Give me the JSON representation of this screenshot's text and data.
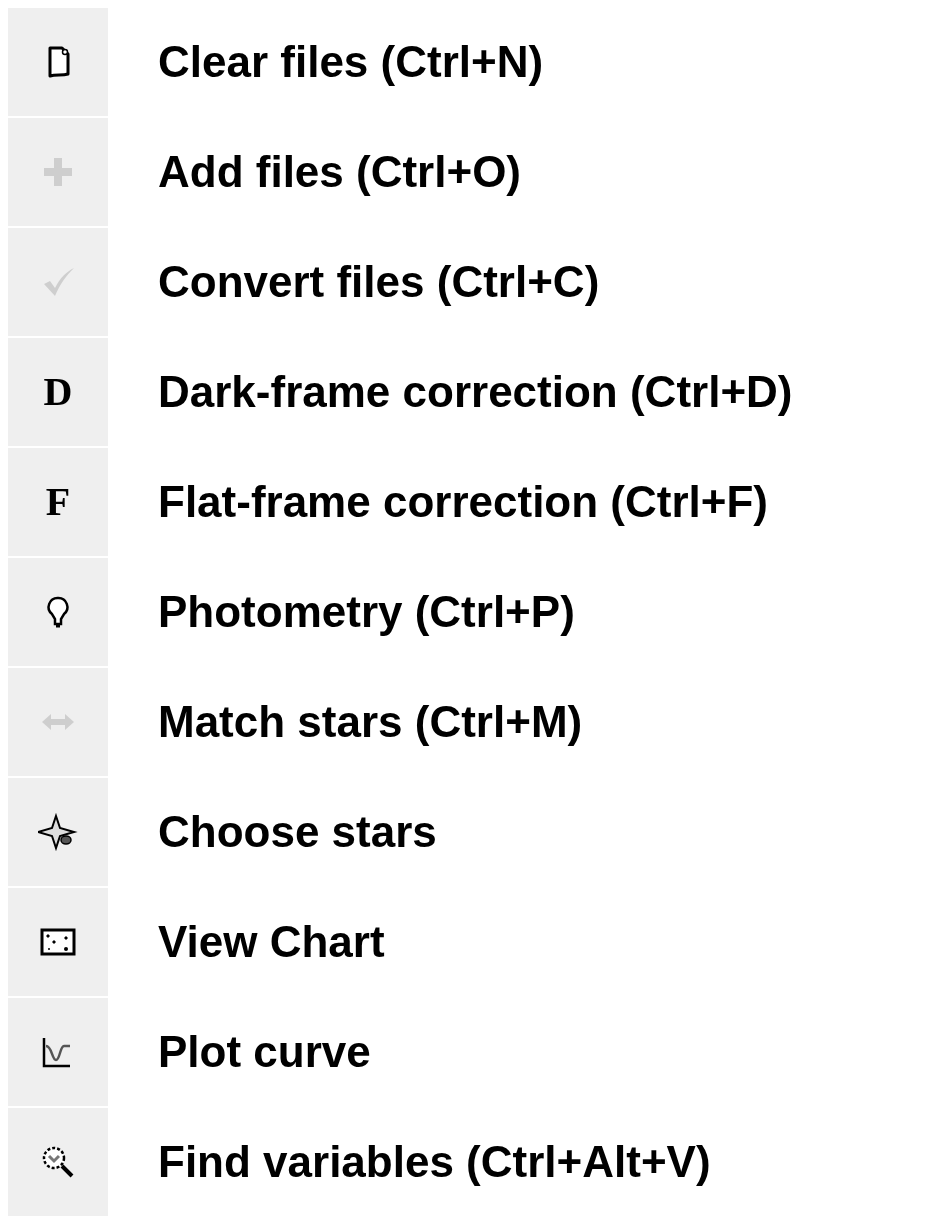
{
  "items": [
    {
      "kind": "page",
      "disabled": false,
      "label": "Clear files (Ctrl+N)"
    },
    {
      "kind": "plus",
      "disabled": true,
      "label": "Add files (Ctrl+O)"
    },
    {
      "kind": "check",
      "disabled": true,
      "label": "Convert files (Ctrl+C)"
    },
    {
      "kind": "letter",
      "glyph": "D",
      "disabled": false,
      "label": "Dark-frame correction (Ctrl+D)"
    },
    {
      "kind": "letter",
      "glyph": "F",
      "disabled": false,
      "label": "Flat-frame correction (Ctrl+F)"
    },
    {
      "kind": "bulb",
      "disabled": false,
      "label": "Photometry (Ctrl+P)"
    },
    {
      "kind": "arrows",
      "disabled": true,
      "label": "Match stars (Ctrl+M)"
    },
    {
      "kind": "star",
      "disabled": false,
      "label": "Choose stars"
    },
    {
      "kind": "chart",
      "disabled": false,
      "label": "View Chart"
    },
    {
      "kind": "curve",
      "disabled": false,
      "label": "Plot curve"
    },
    {
      "kind": "magnifier",
      "disabled": false,
      "label": "Find variables (Ctrl+Alt+V)"
    }
  ]
}
